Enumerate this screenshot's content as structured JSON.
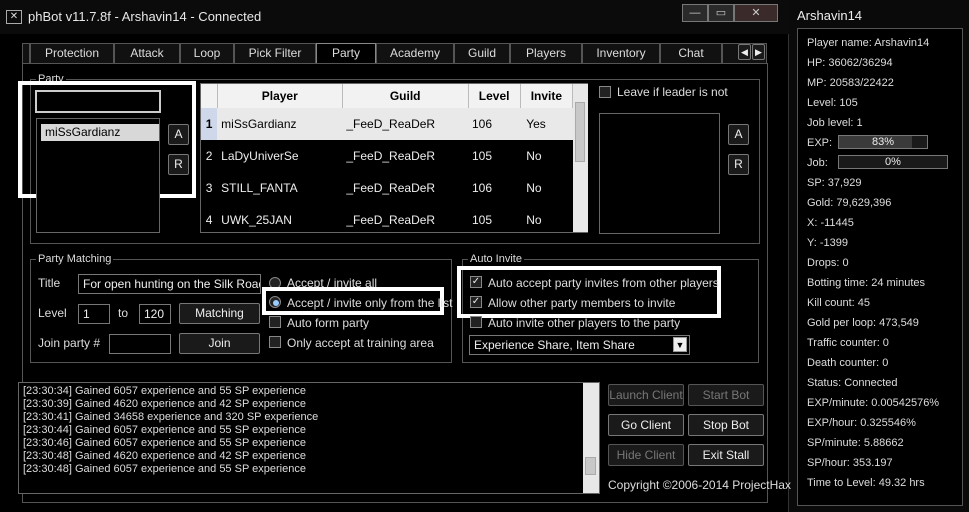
{
  "window": {
    "title": "phBot v11.7.8f - Arshavin14 - Connected"
  },
  "tabs": [
    "Protection",
    "Attack",
    "Loop",
    "Pick Filter",
    "Party",
    "Academy",
    "Guild",
    "Players",
    "Inventory",
    "Chat"
  ],
  "active_tab": "Party",
  "party": {
    "group_title": "Party",
    "name_input": "",
    "list": [
      "miSsGardianz"
    ],
    "add_btn": "A",
    "remove_btn": "R",
    "table": {
      "headers": [
        "Player",
        "Guild",
        "Level",
        "Invite"
      ],
      "rows": [
        {
          "num": "1",
          "player": "miSsGardianz",
          "guild": "_FeeD_ReaDeR",
          "level": "106",
          "invite": "Yes"
        },
        {
          "num": "2",
          "player": "LaDyUniverSe",
          "guild": "_FeeD_ReaDeR",
          "level": "105",
          "invite": "No"
        },
        {
          "num": "3",
          "player": "STILL_FANTA",
          "guild": "_FeeD_ReaDeR",
          "level": "106",
          "invite": "No"
        },
        {
          "num": "4",
          "player": "UWK_25JAN",
          "guild": "_FeeD_ReaDeR",
          "level": "105",
          "invite": "No"
        }
      ]
    },
    "leave_if_leader_label": "Leave if leader is not",
    "right_add_btn": "A",
    "right_remove_btn": "R"
  },
  "matching": {
    "group_title": "Party Matching",
    "title_label": "Title",
    "title_value": "For open hunting on the Silk Road!",
    "level_label": "Level",
    "level_from": "1",
    "to_label": "to",
    "level_to": "120",
    "matching_btn": "Matching",
    "join_label": "Join party #",
    "join_value": "",
    "join_btn": "Join",
    "accept_all": "Accept / invite all",
    "accept_list": "Accept / invite only from the list",
    "auto_form": "Auto form party",
    "only_training": "Only accept at training area"
  },
  "auto_invite": {
    "group_title": "Auto Invite",
    "auto_accept": "Auto accept party invites from other players",
    "allow_others": "Allow other party members to invite",
    "auto_invite_others": "Auto invite other players to the party",
    "share_select": "Experience Share, Item Share"
  },
  "log": [
    "[23:30:34] Gained 6057 experience and 55 SP experience",
    "[23:30:39] Gained 4620 experience and 42 SP experience",
    "[23:30:41] Gained 34658 experience and 320 SP experience",
    "[23:30:44] Gained 6057 experience and 55 SP experience",
    "[23:30:46] Gained 6057 experience and 55 SP experience",
    "[23:30:48] Gained 4620 experience and 42 SP experience",
    "[23:30:48] Gained 6057 experience and 55 SP experience"
  ],
  "controls": {
    "launch_client": "Launch Client",
    "start_bot": "Start Bot",
    "go_client": "Go Client",
    "stop_bot": "Stop Bot",
    "hide_client": "Hide Client",
    "exit_stall": "Exit Stall",
    "copyright": "Copyright ©2006-2014 ProjectHax"
  },
  "side": {
    "title": "Arshavin14",
    "player_name": "Player name: Arshavin14",
    "hp": "HP: 36062/36294",
    "mp": "MP: 20583/22422",
    "level": "Level: 105",
    "job_level": "Job level: 1",
    "exp_label": "EXP:",
    "exp_value": "83%",
    "exp_fraction": 0.83,
    "job_label": "Job:",
    "job_value": "0%",
    "job_fraction": 0.0,
    "sp": "SP: 37,929",
    "gold": "Gold: 79,629,396",
    "x": "X: -11445",
    "y": "Y: -1399",
    "drops": "Drops: 0",
    "botting_time": "Botting time: 24 minutes",
    "kill_count": "Kill count: 45",
    "gold_per_loop": "Gold per loop: 473,549",
    "traffic_counter": "Traffic counter: 0",
    "death_counter": "Death counter: 0",
    "status": "Status: Connected",
    "exp_minute": "EXP/minute: 0.00542576%",
    "exp_hour": "EXP/hour: 0.325546%",
    "sp_minute": "SP/minute: 5.88662",
    "sp_hour": "SP/hour: 353.197",
    "time_to_level": "Time to Level: 49.32 hrs"
  }
}
